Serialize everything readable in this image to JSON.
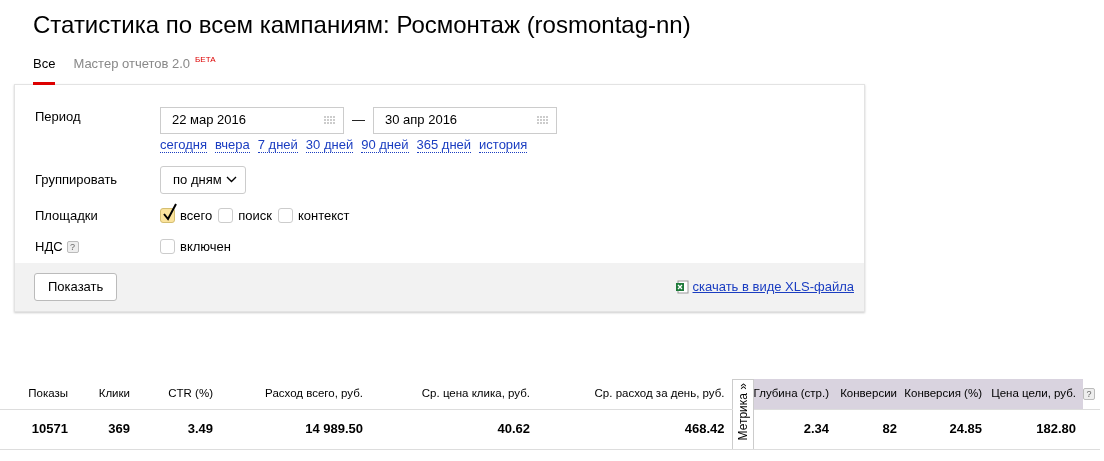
{
  "title": "Статистика по всем кампаниям: Росмонтаж (rosmontag-nn)",
  "tabs": [
    {
      "label": "Все",
      "selected": true
    },
    {
      "label": "Мастер отчетов 2.0",
      "selected": false,
      "badge": "БЕТА"
    }
  ],
  "filters": {
    "period": {
      "label": "Период",
      "from": "22 мар 2016",
      "separator": "—",
      "to": "30 апр 2016",
      "presets": [
        "сегодня",
        "вчера",
        "7 дней",
        "30 дней",
        "90 дней",
        "365 дней",
        "история"
      ]
    },
    "group": {
      "label": "Группировать",
      "value": "по дням"
    },
    "platforms": {
      "label": "Площадки",
      "options": [
        {
          "label": "всего",
          "checked": true
        },
        {
          "label": "поиск",
          "checked": false
        },
        {
          "label": "контекст",
          "checked": false
        }
      ]
    },
    "vat": {
      "label": "НДС",
      "help": "?",
      "option": {
        "label": "включен",
        "checked": false
      }
    },
    "show_button": "Показать",
    "download_link": "скачать в виде XLS-файла"
  },
  "table": {
    "columns": [
      {
        "label": "Показы",
        "kind": "main"
      },
      {
        "label": "Клики",
        "kind": "main"
      },
      {
        "label": "CTR (%)",
        "kind": "main"
      },
      {
        "label": "Расход всего, руб.",
        "kind": "main"
      },
      {
        "label": "Ср. цена клика, руб.",
        "kind": "main"
      },
      {
        "label": "Ср. расход за день, руб.",
        "kind": "main"
      },
      {
        "label": "Глубина (стр.)",
        "kind": "metrika"
      },
      {
        "label": "Конверсии",
        "kind": "metrika"
      },
      {
        "label": "Конверсия (%)",
        "kind": "metrika"
      },
      {
        "label": "Цена цели, руб.",
        "kind": "metrika"
      }
    ],
    "metrika_tab": "Метрика »",
    "help": "?",
    "rows": [
      [
        "10571",
        "369",
        "3.49",
        "14 989.50",
        "40.62",
        "468.42",
        "2.34",
        "82",
        "24.85",
        "182.80"
      ]
    ]
  }
}
